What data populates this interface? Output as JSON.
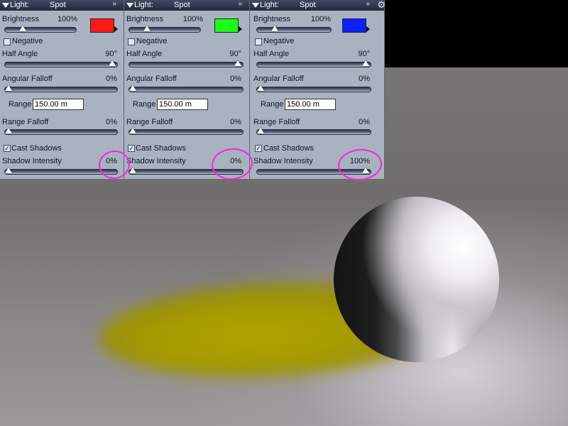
{
  "panels": [
    {
      "header": {
        "label": "Light:",
        "type": "Spot"
      },
      "brightness": {
        "label": "Brightness",
        "value": "100%",
        "color": "#ff1a1a"
      },
      "negative": {
        "label": "Negative",
        "checked": false
      },
      "half_angle": {
        "label": "Half Angle",
        "value": "90°"
      },
      "angular_falloff": {
        "label": "Angular Falloff",
        "value": "0%"
      },
      "range": {
        "label": "Range",
        "value": "150.00 m"
      },
      "range_falloff": {
        "label": "Range Falloff",
        "value": "0%"
      },
      "cast_shadows": {
        "label": "Cast Shadows",
        "checked": true
      },
      "shadow_intensity": {
        "label": "Shadow Intensity",
        "value": "0%"
      }
    },
    {
      "header": {
        "label": "Light:",
        "type": "Spot"
      },
      "brightness": {
        "label": "Brightness",
        "value": "100%",
        "color": "#1aff1a"
      },
      "negative": {
        "label": "Negative",
        "checked": false
      },
      "half_angle": {
        "label": "Half Angle",
        "value": "90°"
      },
      "angular_falloff": {
        "label": "Angular Falloff",
        "value": "0%"
      },
      "range": {
        "label": "Range",
        "value": "150.00 m"
      },
      "range_falloff": {
        "label": "Range Falloff",
        "value": "0%"
      },
      "cast_shadows": {
        "label": "Cast Shadows",
        "checked": true
      },
      "shadow_intensity": {
        "label": "Shadow Intensity",
        "value": "0%"
      }
    },
    {
      "header": {
        "label": "Light:",
        "type": "Spot"
      },
      "brightness": {
        "label": "Brightness",
        "value": "100%",
        "color": "#0f1fff"
      },
      "negative": {
        "label": "Negative",
        "checked": false
      },
      "half_angle": {
        "label": "Half Angle",
        "value": "90°"
      },
      "angular_falloff": {
        "label": "Angular Falloff",
        "value": "0%"
      },
      "range": {
        "label": "Range",
        "value": "150.00 m"
      },
      "range_falloff": {
        "label": "Range Falloff",
        "value": "0%"
      },
      "cast_shadows": {
        "label": "Cast Shadows",
        "checked": true
      },
      "shadow_intensity": {
        "label": "Shadow Intensity",
        "value": "100%"
      }
    }
  ],
  "icons": {
    "collapse": "triangle-down-icon",
    "menu": "chevron-down-icon",
    "settings": "gear-icon"
  },
  "annotation_color": "#ff22dd",
  "render": {
    "sphere": "white sphere",
    "spot": "yellow spotlight pool"
  }
}
